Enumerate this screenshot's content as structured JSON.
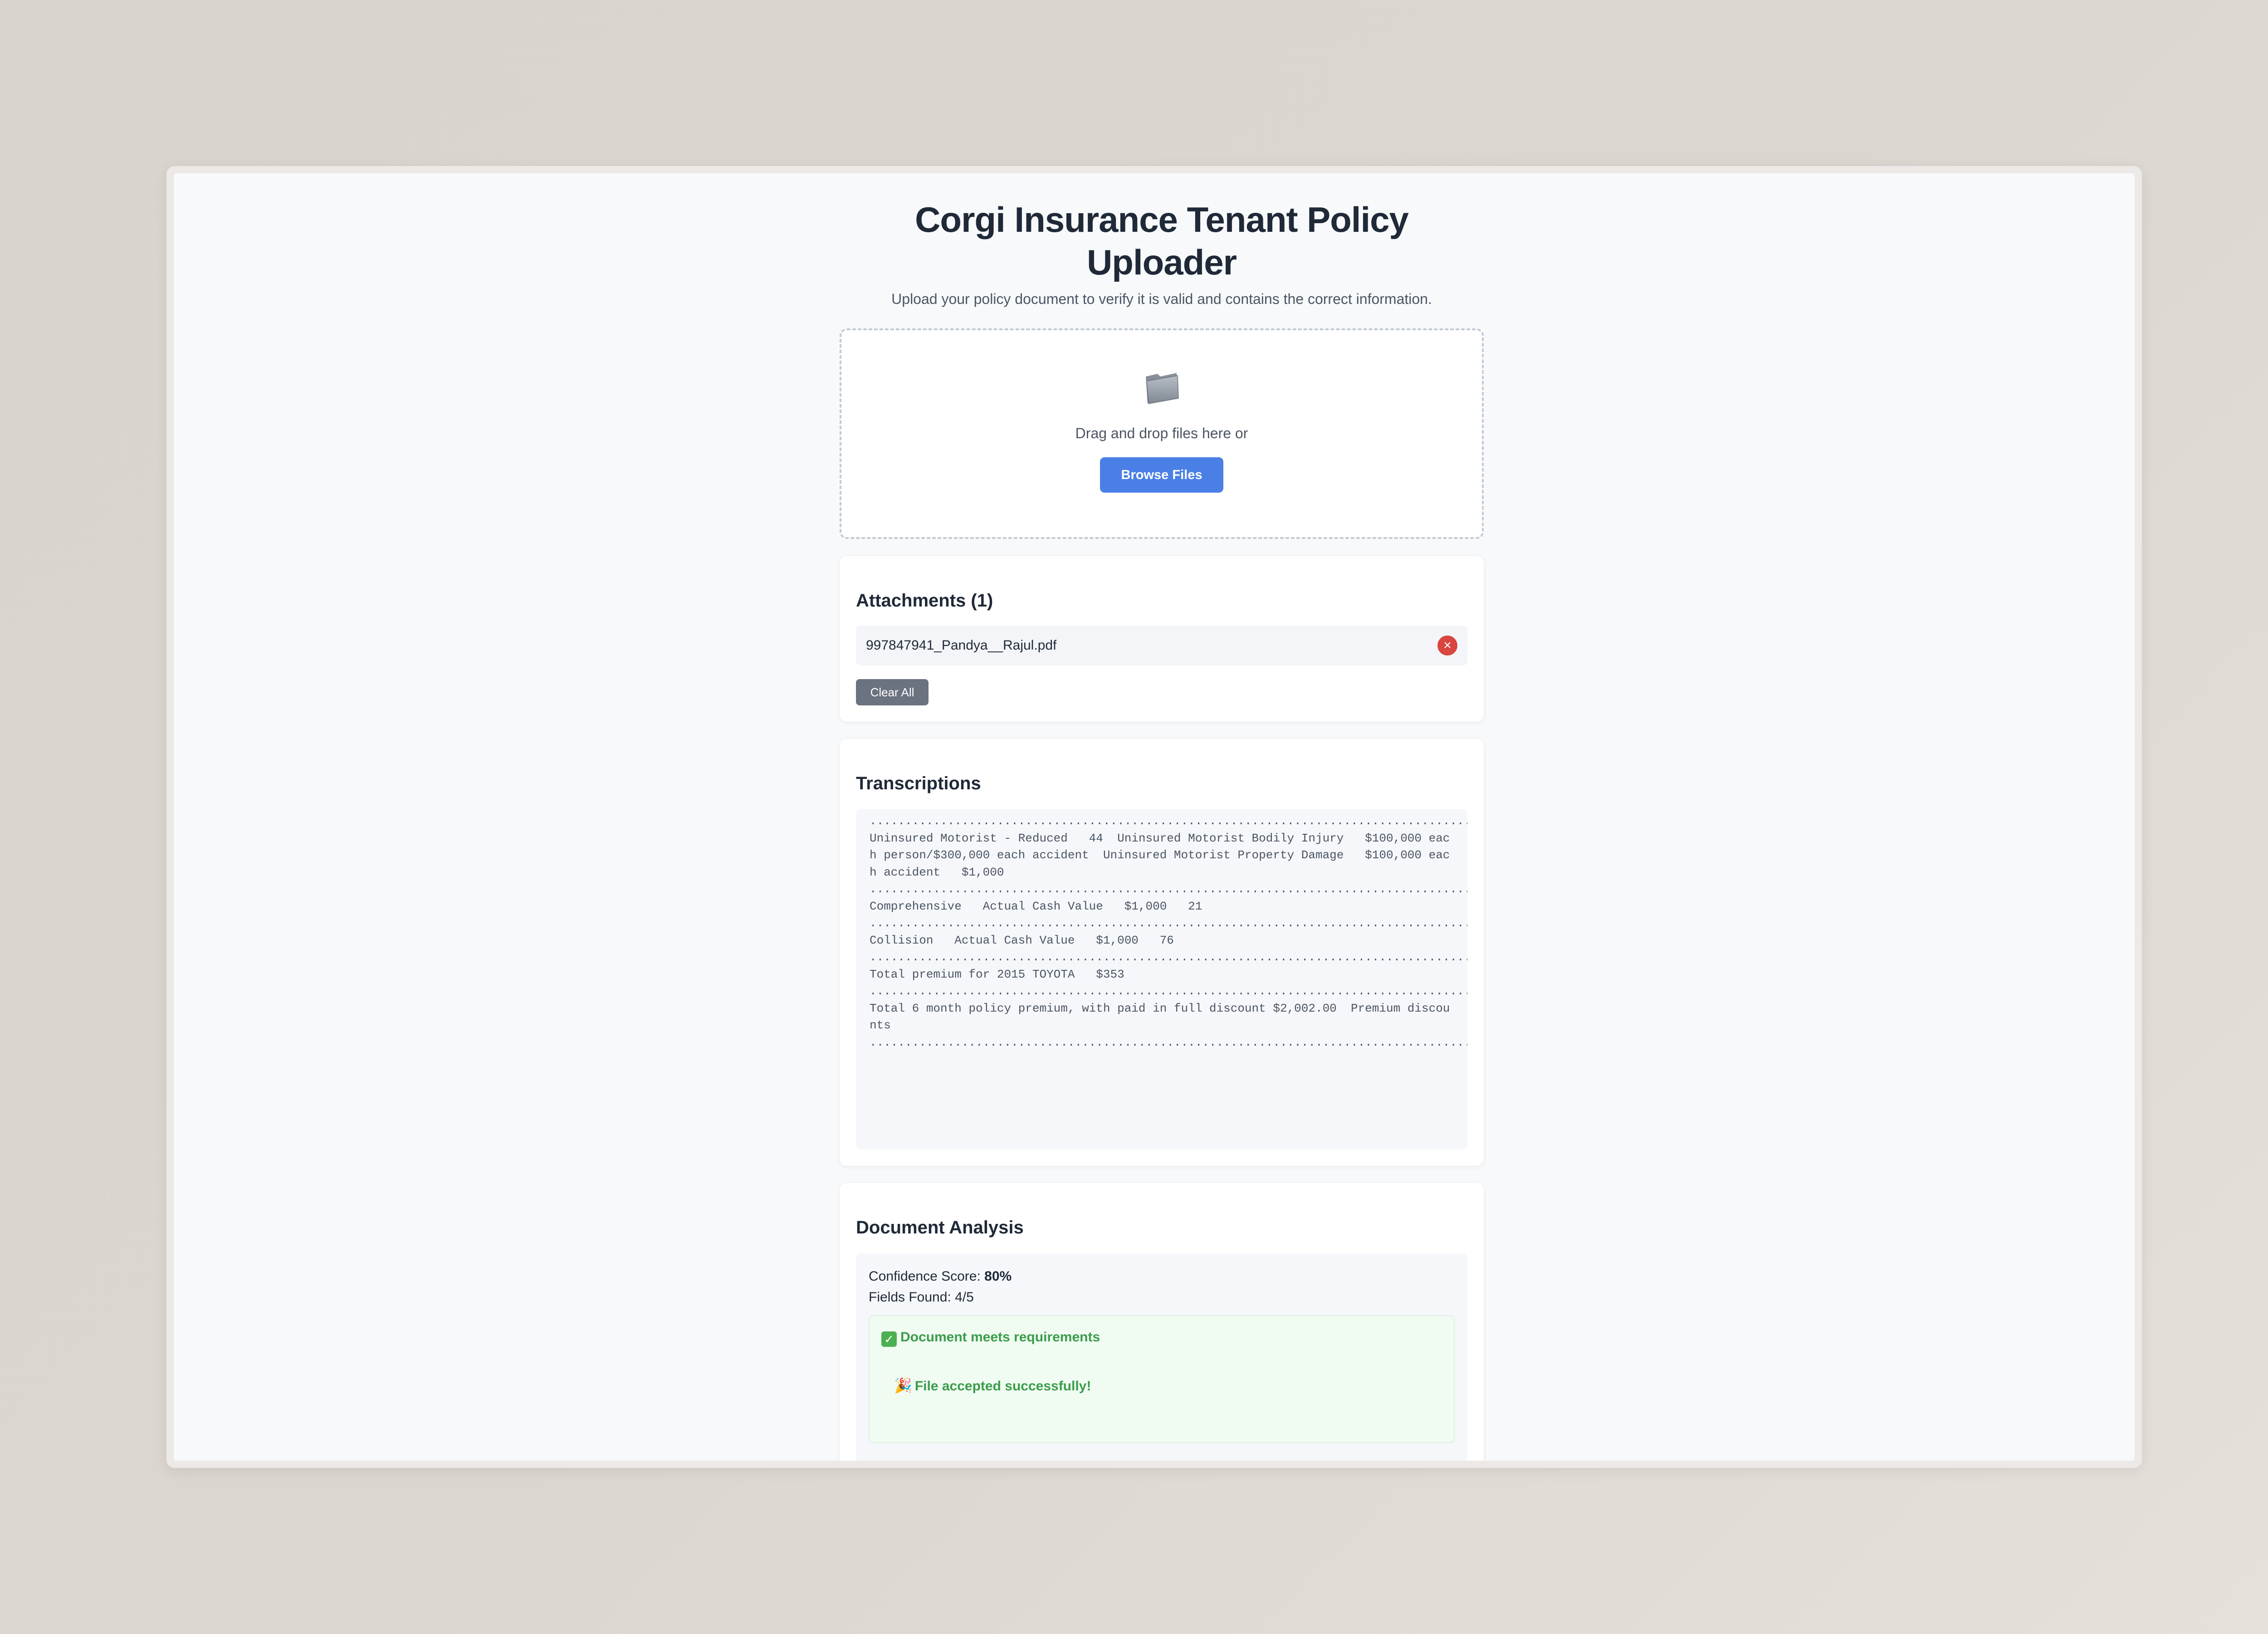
{
  "header": {
    "title": "Corgi Insurance Tenant Policy Uploader",
    "subtitle": "Upload your policy document to verify it is valid and contains the correct information."
  },
  "dropzone": {
    "icon": "folder-icon",
    "text": "Drag and drop files here or",
    "browse_label": "Browse Files"
  },
  "attachments": {
    "title": "Attachments (1)",
    "files": [
      {
        "name": "997847941_Pandya__Rajul.pdf"
      }
    ],
    "clear_label": "Clear All"
  },
  "transcriptions": {
    "title": "Transcriptions",
    "text": "...................................................................................................................................................................................  Uninsured Motorist - Reduced   44  Uninsured Motorist Bodily Injury   $100,000 each person/$300,000 each accident  Uninsured Motorist Property Damage   $100,000 each accident   $1,000 ...................................................................................................................................................................................  Comprehensive   Actual Cash Value   $1,000   21 ...................................................................................................................................................................................  Collision   Actual Cash Value   $1,000   76 ...................................................................................................................................................................................  Total premium for 2015 TOYOTA   $353 ...................................................................................................................................................................................  Total 6 month policy premium, with paid in full discount $2,002.00  Premium discounts .................................................................................................................................................................."
  },
  "analysis": {
    "title": "Document Analysis",
    "confidence_label": "Confidence Score: ",
    "confidence_value": "80%",
    "fields_found": "Fields Found: 4/5",
    "requirements_text": "Document meets requirements",
    "accepted_text": "File accepted successfully!"
  },
  "colors": {
    "accent": "#4a80e6",
    "success": "#3a9d4a",
    "danger": "#d9453f",
    "secondary_button": "#6b7280"
  }
}
